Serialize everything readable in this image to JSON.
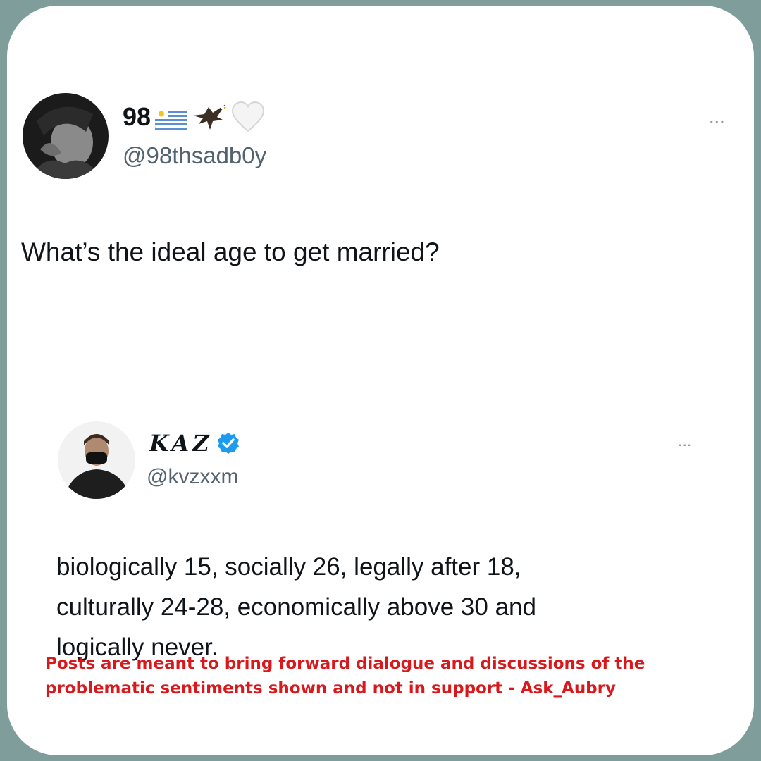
{
  "post1": {
    "display_name": "98",
    "name_emojis": [
      "uruguay-flag-icon",
      "eagle-icon",
      "white-heart-icon"
    ],
    "handle": "@98thsadb0y",
    "more_label": "...",
    "text": "What’s the ideal age to get married?"
  },
  "post2": {
    "display_name": "KAZ",
    "verified": true,
    "handle": "@kvzxxm",
    "more_label": "...",
    "text_lines": [
      "biologically 15, socially 26, legally after 18,",
      "culturally 24-28, economically above 30 and",
      "logically never."
    ]
  },
  "disclaimer": {
    "line1": "Posts are meant to bring forward dialogue and discussions of the",
    "line2": "problematic sentiments shown and not in support - Ask_Aubry"
  },
  "colors": {
    "frame": "#7f9e9b",
    "card": "#ffffff",
    "text": "#0f1419",
    "handle": "#536471",
    "verified": "#1d9bf0",
    "disclaimer": "#d9181c"
  }
}
